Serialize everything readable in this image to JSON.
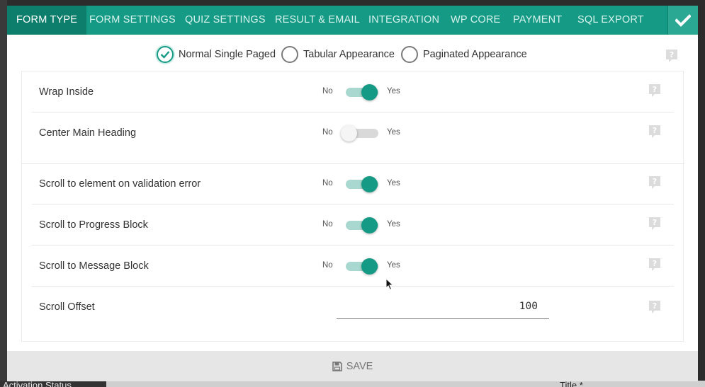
{
  "tabs": [
    {
      "label": "FORM TYPE",
      "active": true
    },
    {
      "label": "FORM SETTINGS"
    },
    {
      "label": "QUIZ SETTINGS"
    },
    {
      "label": "RESULT & EMAIL"
    },
    {
      "label": "INTEGRATION"
    },
    {
      "label": "WP CORE"
    },
    {
      "label": "PAYMENT"
    },
    {
      "label": "SQL EXPORT"
    }
  ],
  "form_type_options": [
    {
      "label": "Normal Single Paged",
      "checked": true
    },
    {
      "label": "Tabular Appearance",
      "checked": false
    },
    {
      "label": "Paginated Appearance",
      "checked": false
    }
  ],
  "toggle_no": "No",
  "toggle_yes": "Yes",
  "settings": [
    {
      "label": "Wrap Inside",
      "value": true
    },
    {
      "label": "Center Main Heading",
      "value": false
    },
    {
      "label": "Scroll to element on validation error",
      "value": true
    },
    {
      "label": "Scroll to Progress Block",
      "value": true
    },
    {
      "label": "Scroll to Message Block",
      "value": true
    }
  ],
  "scroll_offset": {
    "label": "Scroll Offset",
    "value": "100"
  },
  "footer": {
    "save_label": "SAVE"
  },
  "background_text": {
    "activation_status": "Activation Status",
    "title": "Title *"
  },
  "colors": {
    "accent": "#159a85",
    "active_tab": "#0e7e6c",
    "footer": "#e6e6e6"
  },
  "icons": {
    "confirm": "checkmark-icon",
    "help": "question-bubble-icon",
    "save": "floppy-disk-icon",
    "cursor": "mouse-pointer-icon"
  }
}
